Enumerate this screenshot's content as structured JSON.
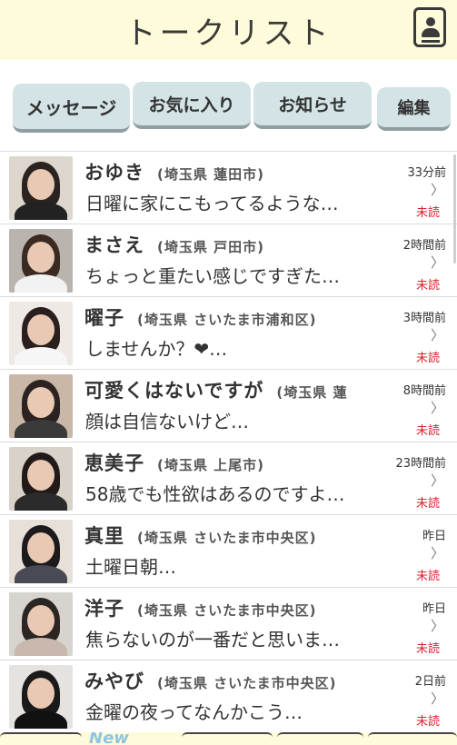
{
  "header": {
    "title": "トークリスト"
  },
  "tabs": {
    "messages": "メッセージ",
    "favorites": "お気に入り",
    "notices": "お知らせ",
    "edit": "編集"
  },
  "conversations": [
    {
      "name": "おゆき",
      "location": "(埼玉県 蓮田市)",
      "message": "日曜に家にこもってるような…",
      "time": "33分前",
      "status": "未読"
    },
    {
      "name": "まさえ",
      "location": "(埼玉県 戸田市)",
      "message": "ちょっと重たい感じですぎた…",
      "time": "2時間前",
      "status": "未読"
    },
    {
      "name": "曜子",
      "location": "(埼玉県 さいたま市浦和区)",
      "message": "しませんか？❤…",
      "time": "3時間前",
      "status": "未読"
    },
    {
      "name": "可愛くはないですが",
      "location": "(埼玉県 蓮",
      "message": "顔は自信ないけど…",
      "time": "8時間前",
      "status": "未読"
    },
    {
      "name": "恵美子",
      "location": "(埼玉県 上尾市)",
      "message": "58歳でも性欲はあるのですよ…",
      "time": "23時間前",
      "status": "未読"
    },
    {
      "name": "真里",
      "location": "(埼玉県 さいたま市中央区)",
      "message": "土曜日朝…",
      "time": "昨日",
      "status": "未読"
    },
    {
      "name": "洋子",
      "location": "(埼玉県 さいたま市中央区)",
      "message": "焦らないのが一番だと思いま…",
      "time": "昨日",
      "status": "未読"
    },
    {
      "name": "みやび",
      "location": "(埼玉県 さいたま市中央区)",
      "message": "金曜の夜ってなんかこう…",
      "time": "2日前",
      "status": "未読"
    }
  ],
  "chevron": "〉",
  "bottom_nav": {
    "new_label": "New"
  },
  "colors": {
    "header_bg": "#fdfbd9",
    "tab_bg": "#d3e3e6",
    "unread": "#d9232d"
  }
}
